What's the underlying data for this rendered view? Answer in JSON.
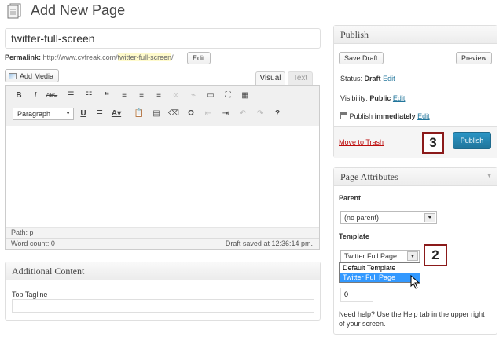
{
  "header": {
    "title": "Add New Page"
  },
  "post": {
    "title": "twitter-full-screen",
    "permalink_label": "Permalink:",
    "permalink_base": "http://www.cvfreak.com/",
    "permalink_slug": "twitter-full-screen",
    "permalink_tail": "/",
    "permalink_edit": "Edit"
  },
  "editor": {
    "add_media": "Add Media",
    "tab_visual": "Visual",
    "tab_text": "Text",
    "format_value": "Paragraph",
    "path": "Path: p",
    "word_count": "Word count: 0",
    "draft_saved": "Draft saved at 12:36:14 pm."
  },
  "additional_content": {
    "title": "Additional Content",
    "tagline_label": "Top Tagline",
    "tagline_value": ""
  },
  "publish": {
    "title": "Publish",
    "save_draft": "Save Draft",
    "preview": "Preview",
    "status_label": "Status:",
    "status_value": "Draft",
    "visibility_label": "Visibility:",
    "visibility_value": "Public",
    "schedule_label": "Publish",
    "schedule_value": "immediately",
    "edit": "Edit",
    "move_to_trash": "Move to Trash",
    "publish_button": "Publish",
    "callout": "3"
  },
  "attributes": {
    "title": "Page Attributes",
    "parent_label": "Parent",
    "parent_value": "(no parent)",
    "template_label": "Template",
    "template_value": "Twitter Full Page",
    "template_options": [
      "Default Template",
      "Twitter Full Page"
    ],
    "order_value": "0",
    "help": "Need help? Use the Help tab in the upper right of your screen.",
    "callout": "2"
  }
}
